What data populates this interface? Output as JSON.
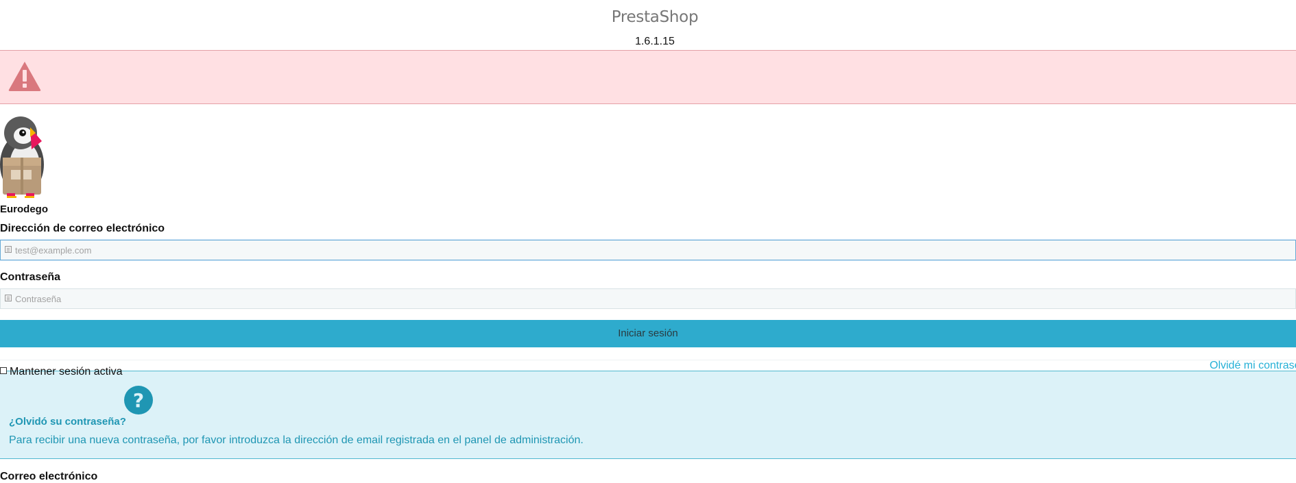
{
  "header": {
    "brand": "PrestaShop",
    "version": "1.6.1.15"
  },
  "error_banner": {
    "icon": "warning-triangle-icon",
    "color": "#d9787e"
  },
  "shop": {
    "mascot": "puffin-mascot-logo",
    "name": "Eurodego"
  },
  "login_form": {
    "email_label": "Dirección de correo electrónico",
    "email_placeholder": "test@example.com",
    "password_label": "Contraseña",
    "password_placeholder": "Contraseña",
    "submit_label": "Iniciar sesión",
    "remember_label": "Mantener sesión activa",
    "forgot_link": "Olvidé mi contrase"
  },
  "forgot_info": {
    "icon": "question-circle-icon",
    "title": "¿Olvidó su contraseña?",
    "text": "Para recibir una nueva contraseña, por favor introduzca la dirección de email registrada en el panel de administración."
  },
  "forgot_form": {
    "email_label": "Correo electrónico"
  },
  "colors": {
    "accent": "#2eabcd",
    "error_bg": "#ffe0e3",
    "info_bg": "#dcf2f8",
    "info_text": "#1f96b3",
    "link": "#25b0d6"
  }
}
